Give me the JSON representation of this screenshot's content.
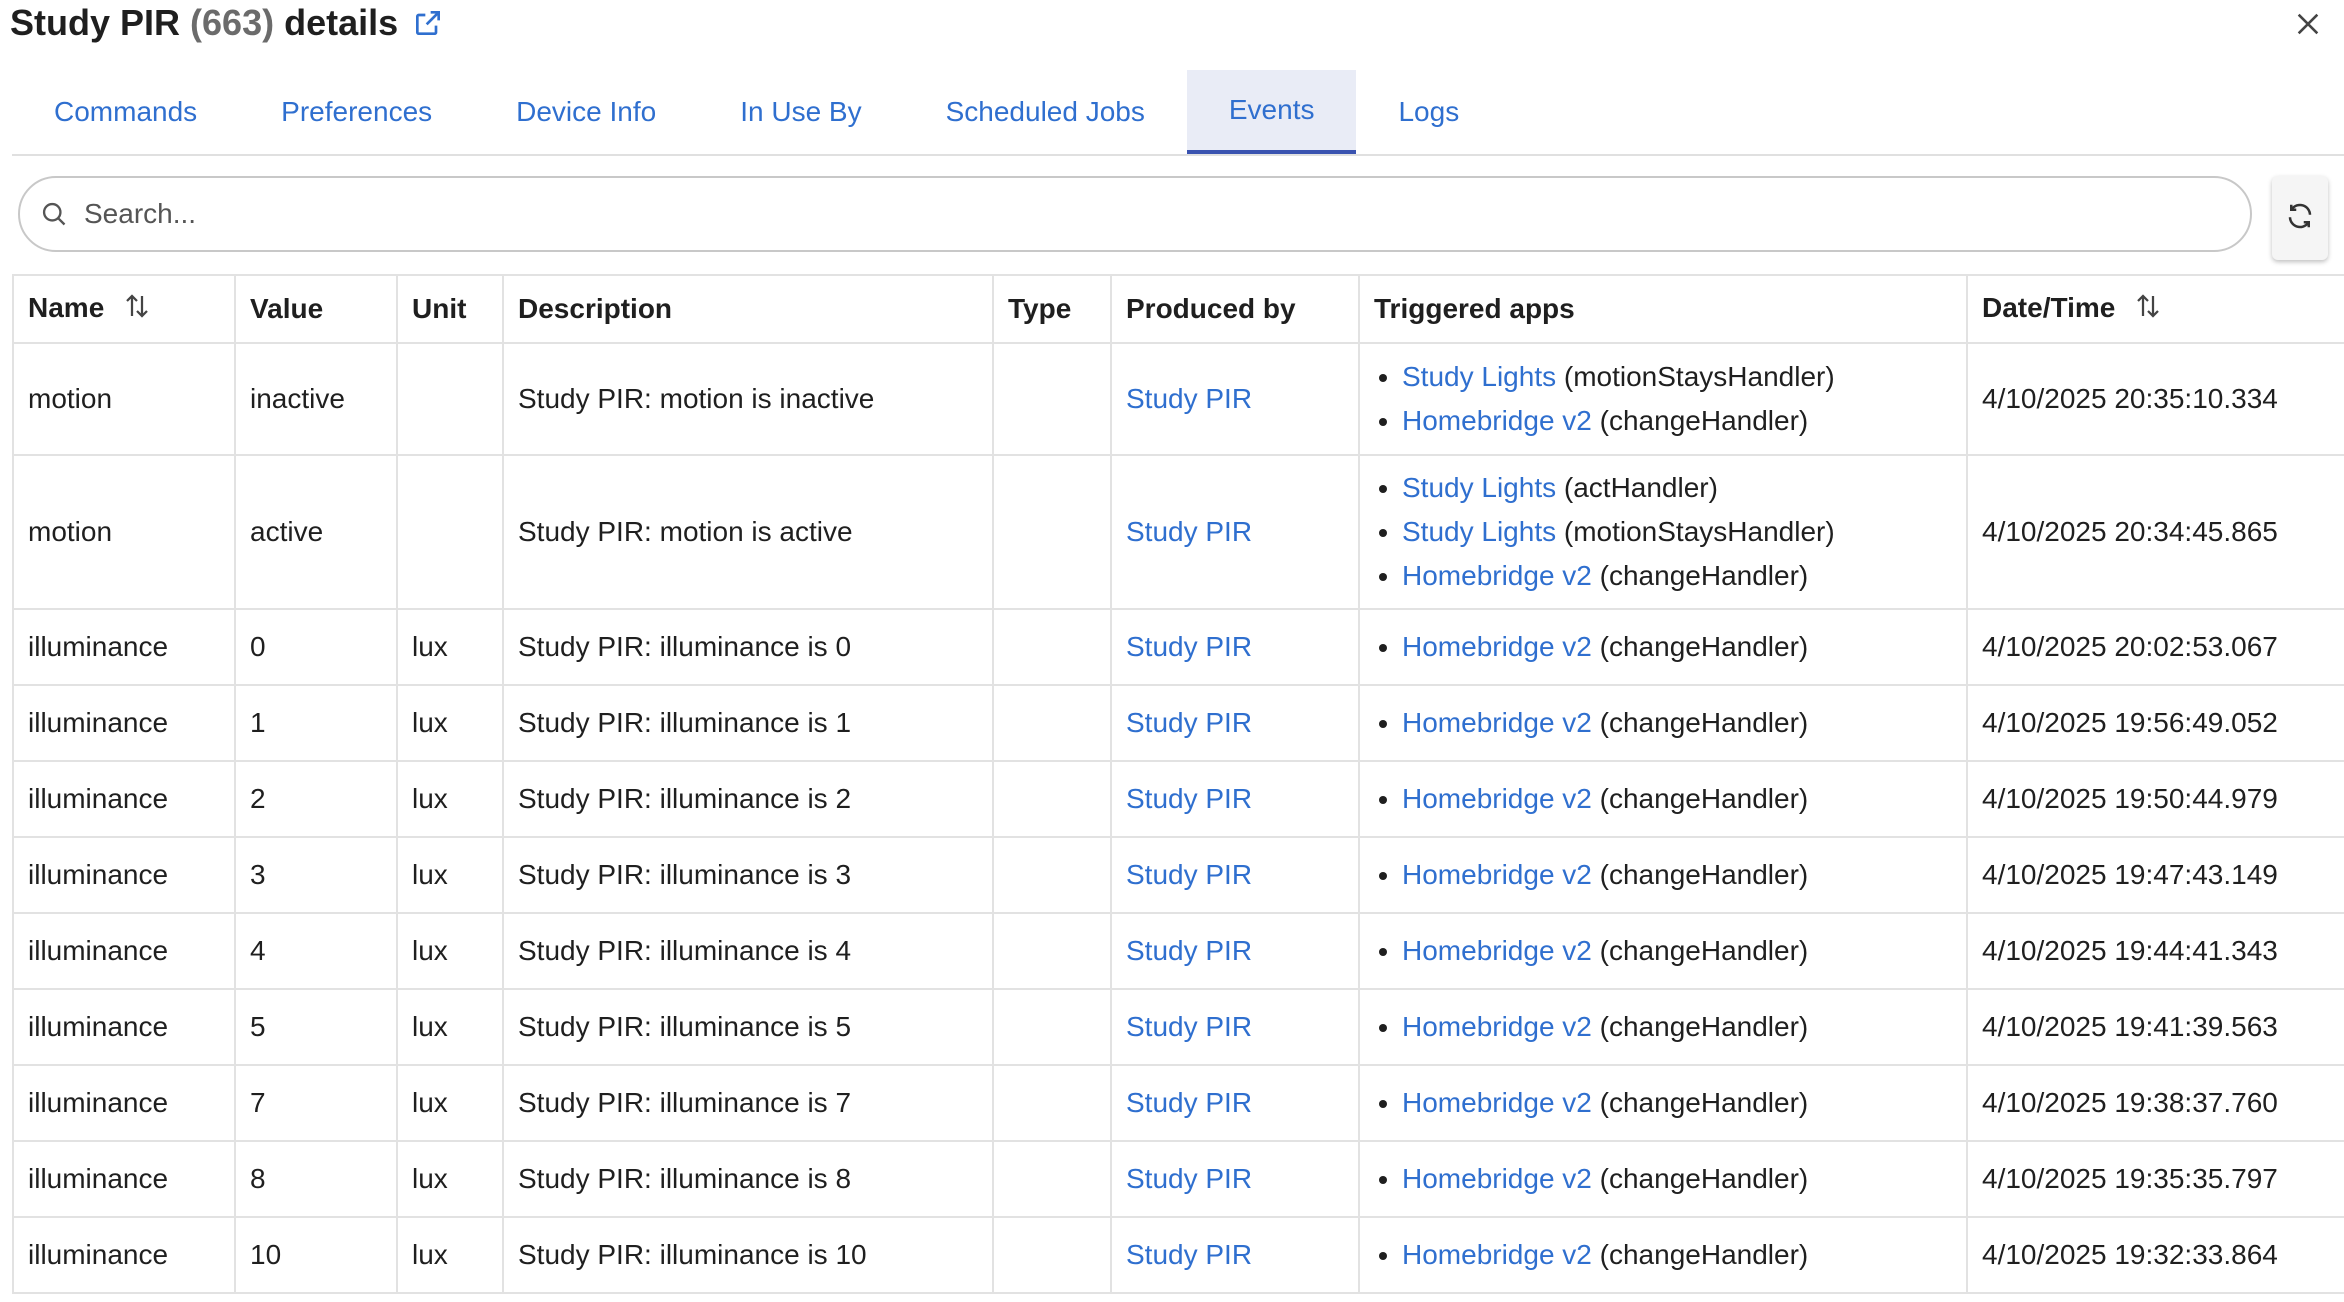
{
  "header": {
    "title": "Study PIR",
    "count": "(663)",
    "suffix": "details"
  },
  "icons": {
    "external_link": "external-link-icon",
    "close": "close-icon",
    "search": "search-icon",
    "refresh": "refresh-icon",
    "sort": "sort-icon"
  },
  "colors": {
    "link": "#2f6fcf",
    "active_tab_bg": "#e9ecf6",
    "active_tab_underline": "#3a53b0"
  },
  "tabs": [
    {
      "label": "Commands",
      "active": false
    },
    {
      "label": "Preferences",
      "active": false
    },
    {
      "label": "Device Info",
      "active": false
    },
    {
      "label": "In Use By",
      "active": false
    },
    {
      "label": "Scheduled Jobs",
      "active": false
    },
    {
      "label": "Events",
      "active": true
    },
    {
      "label": "Logs",
      "active": false
    }
  ],
  "search": {
    "placeholder": "Search...",
    "value": ""
  },
  "table": {
    "columns": [
      "Name",
      "Value",
      "Unit",
      "Description",
      "Type",
      "Produced by",
      "Triggered apps",
      "Date/Time"
    ],
    "rows": [
      {
        "name": "motion",
        "value": "inactive",
        "unit": "",
        "description": "Study PIR: motion is inactive",
        "type": "",
        "produced_by": "Study PIR",
        "apps": [
          {
            "app": "Study Lights",
            "handler": "(motionStaysHandler)"
          },
          {
            "app": "Homebridge v2",
            "handler": "(changeHandler)"
          }
        ],
        "datetime": "4/10/2025 20:35:10.334"
      },
      {
        "name": "motion",
        "value": "active",
        "unit": "",
        "description": "Study PIR: motion is active",
        "type": "",
        "produced_by": "Study PIR",
        "apps": [
          {
            "app": "Study Lights",
            "handler": "(actHandler)"
          },
          {
            "app": "Study Lights",
            "handler": "(motionStaysHandler)"
          },
          {
            "app": "Homebridge v2",
            "handler": "(changeHandler)"
          }
        ],
        "datetime": "4/10/2025 20:34:45.865"
      },
      {
        "name": "illuminance",
        "value": "0",
        "unit": "lux",
        "description": "Study PIR: illuminance is 0",
        "type": "",
        "produced_by": "Study PIR",
        "apps": [
          {
            "app": "Homebridge v2",
            "handler": "(changeHandler)"
          }
        ],
        "datetime": "4/10/2025 20:02:53.067"
      },
      {
        "name": "illuminance",
        "value": "1",
        "unit": "lux",
        "description": "Study PIR: illuminance is 1",
        "type": "",
        "produced_by": "Study PIR",
        "apps": [
          {
            "app": "Homebridge v2",
            "handler": "(changeHandler)"
          }
        ],
        "datetime": "4/10/2025 19:56:49.052"
      },
      {
        "name": "illuminance",
        "value": "2",
        "unit": "lux",
        "description": "Study PIR: illuminance is 2",
        "type": "",
        "produced_by": "Study PIR",
        "apps": [
          {
            "app": "Homebridge v2",
            "handler": "(changeHandler)"
          }
        ],
        "datetime": "4/10/2025 19:50:44.979"
      },
      {
        "name": "illuminance",
        "value": "3",
        "unit": "lux",
        "description": "Study PIR: illuminance is 3",
        "type": "",
        "produced_by": "Study PIR",
        "apps": [
          {
            "app": "Homebridge v2",
            "handler": "(changeHandler)"
          }
        ],
        "datetime": "4/10/2025 19:47:43.149"
      },
      {
        "name": "illuminance",
        "value": "4",
        "unit": "lux",
        "description": "Study PIR: illuminance is 4",
        "type": "",
        "produced_by": "Study PIR",
        "apps": [
          {
            "app": "Homebridge v2",
            "handler": "(changeHandler)"
          }
        ],
        "datetime": "4/10/2025 19:44:41.343"
      },
      {
        "name": "illuminance",
        "value": "5",
        "unit": "lux",
        "description": "Study PIR: illuminance is 5",
        "type": "",
        "produced_by": "Study PIR",
        "apps": [
          {
            "app": "Homebridge v2",
            "handler": "(changeHandler)"
          }
        ],
        "datetime": "4/10/2025 19:41:39.563"
      },
      {
        "name": "illuminance",
        "value": "7",
        "unit": "lux",
        "description": "Study PIR: illuminance is 7",
        "type": "",
        "produced_by": "Study PIR",
        "apps": [
          {
            "app": "Homebridge v2",
            "handler": "(changeHandler)"
          }
        ],
        "datetime": "4/10/2025 19:38:37.760"
      },
      {
        "name": "illuminance",
        "value": "8",
        "unit": "lux",
        "description": "Study PIR: illuminance is 8",
        "type": "",
        "produced_by": "Study PIR",
        "apps": [
          {
            "app": "Homebridge v2",
            "handler": "(changeHandler)"
          }
        ],
        "datetime": "4/10/2025 19:35:35.797"
      },
      {
        "name": "illuminance",
        "value": "10",
        "unit": "lux",
        "description": "Study PIR: illuminance is 10",
        "type": "",
        "produced_by": "Study PIR",
        "apps": [
          {
            "app": "Homebridge v2",
            "handler": "(changeHandler)"
          }
        ],
        "datetime": "4/10/2025 19:32:33.864"
      }
    ]
  }
}
